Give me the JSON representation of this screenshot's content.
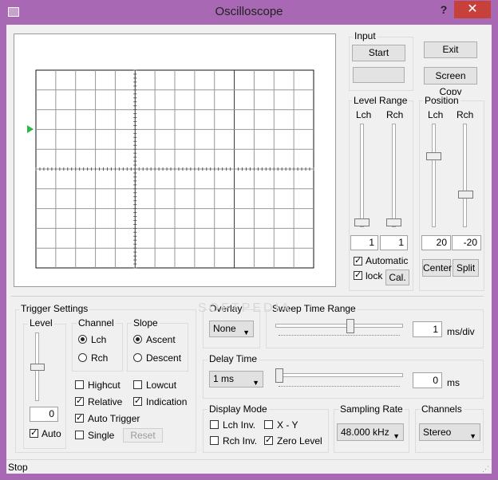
{
  "window": {
    "title": "Oscilloscope",
    "help": "?",
    "close": "✕"
  },
  "input": {
    "legend": "Input",
    "start": "Start",
    "display": ""
  },
  "buttons": {
    "exit": "Exit",
    "screen_copy": "Screen Copy",
    "center": "Center",
    "split": "Split",
    "cal": "Cal."
  },
  "level_range": {
    "legend": "Level Range",
    "lch": "Lch",
    "rch": "Rch",
    "lch_value": "1",
    "rch_value": "1",
    "automatic_label": "Automatic",
    "automatic": true,
    "lock_label": "lock",
    "lock": true
  },
  "position": {
    "legend": "Position",
    "lch": "Lch",
    "rch": "Rch",
    "lch_value": "20",
    "rch_value": "-20"
  },
  "trigger": {
    "legend": "Trigger Settings",
    "level": {
      "legend": "Level",
      "value": "0",
      "auto_label": "Auto",
      "auto": true
    },
    "channel": {
      "legend": "Channel",
      "options": [
        "Lch",
        "Rch"
      ],
      "selected": "Lch"
    },
    "slope": {
      "legend": "Slope",
      "options": [
        "Ascent",
        "Descent"
      ],
      "selected": "Ascent"
    },
    "highcut": "Highcut",
    "lowcut": "Lowcut",
    "relative": "Relative",
    "indication": "Indication",
    "auto_trigger": "Auto Trigger",
    "single": "Single",
    "reset": "Reset"
  },
  "overlay": {
    "legend": "Overlay",
    "value": "None"
  },
  "sweep": {
    "legend": "Sweep Time Range",
    "value": "1",
    "unit": "ms/div"
  },
  "delay": {
    "legend": "Delay Time",
    "select": "1 ms",
    "value": "0",
    "unit": "ms"
  },
  "display_mode": {
    "legend": "Display Mode",
    "lch_inv": "Lch Inv.",
    "xy": "X - Y",
    "rch_inv": "Rch Inv.",
    "zero_level": "Zero Level"
  },
  "sampling": {
    "legend": "Sampling Rate",
    "value": "48.000 kHz"
  },
  "channels": {
    "legend": "Channels",
    "value": "Stereo"
  },
  "status": {
    "text": "Stop"
  },
  "watermark": "SOFTPEDIA"
}
